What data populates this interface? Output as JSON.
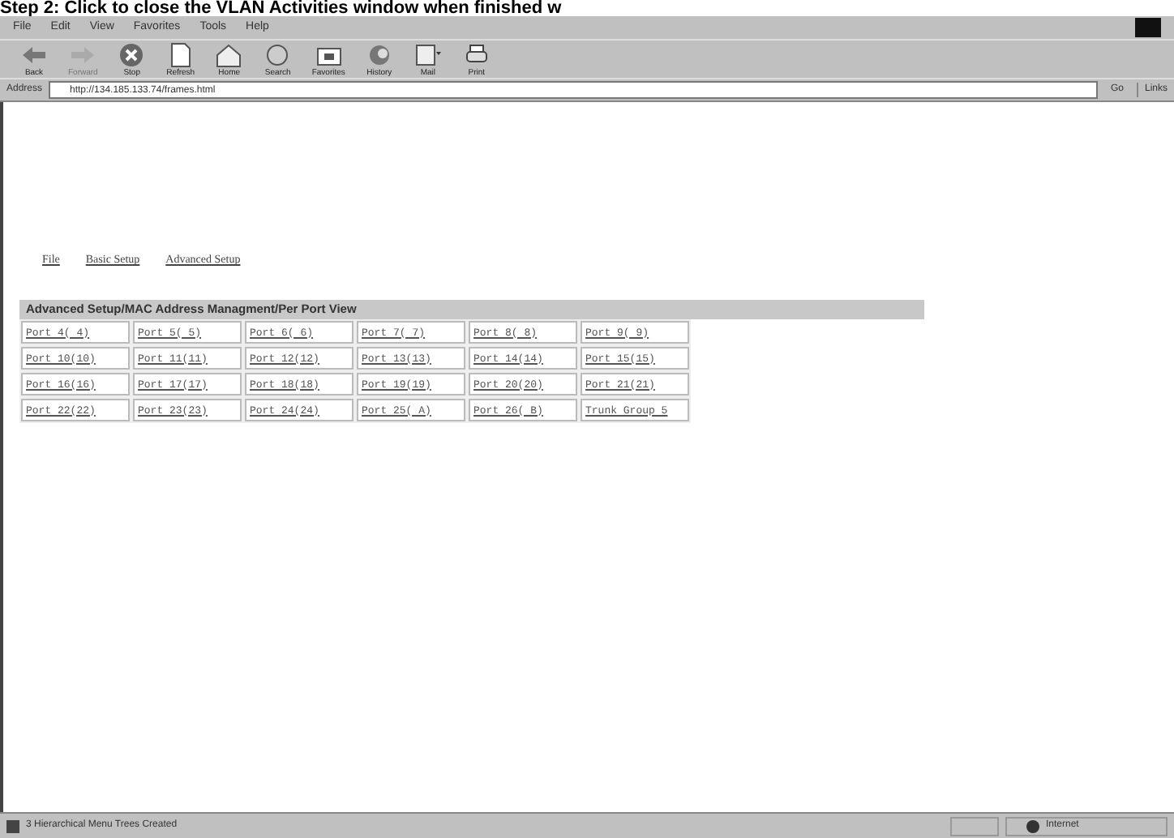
{
  "caption": "Step 2: Click to close the VLAN Activities window when finished w",
  "menu": [
    "File",
    "Edit",
    "View",
    "Favorites",
    "Tools",
    "Help"
  ],
  "toolbar": [
    {
      "label": "Back",
      "kind": "back",
      "disabled": false
    },
    {
      "label": "Forward",
      "kind": "forward",
      "disabled": true
    },
    {
      "label": "Stop",
      "kind": "stop",
      "disabled": false
    },
    {
      "label": "Refresh",
      "kind": "refresh",
      "disabled": false
    },
    {
      "label": "Home",
      "kind": "home",
      "disabled": false
    },
    {
      "label": "Search",
      "kind": "search",
      "disabled": false
    },
    {
      "label": "Favorites",
      "kind": "favorites",
      "disabled": false
    },
    {
      "label": "History",
      "kind": "history",
      "disabled": false
    },
    {
      "label": "Mail",
      "kind": "mail",
      "disabled": false
    },
    {
      "label": "Print",
      "kind": "print",
      "disabled": false
    }
  ],
  "address": {
    "label": "Address",
    "value": "http://134.185.133.74/frames.html",
    "go": "Go",
    "links": "Links"
  },
  "nav": [
    "File",
    "Basic Setup",
    "Advanced Setup"
  ],
  "heading": "Advanced Setup/MAC Address Managment/Per Port View",
  "ports": [
    [
      "Port 4( 4)",
      "Port 5( 5)",
      "Port 6( 6)",
      "Port 7( 7)",
      "Port 8( 8)",
      "Port 9( 9)"
    ],
    [
      "Port 10(10)",
      "Port 11(11)",
      "Port 12(12)",
      "Port 13(13)",
      "Port 14(14)",
      "Port 15(15)"
    ],
    [
      "Port 16(16)",
      "Port 17(17)",
      "Port 18(18)",
      "Port 19(19)",
      "Port 20(20)",
      "Port 21(21)"
    ],
    [
      "Port 22(22)",
      "Port 23(23)",
      "Port 24(24)",
      "Port 25( A)",
      "Port 26( B)",
      "Trunk Group 5"
    ]
  ],
  "status": {
    "text": "3 Hierarchical Menu Trees Created",
    "zone": "Internet"
  }
}
